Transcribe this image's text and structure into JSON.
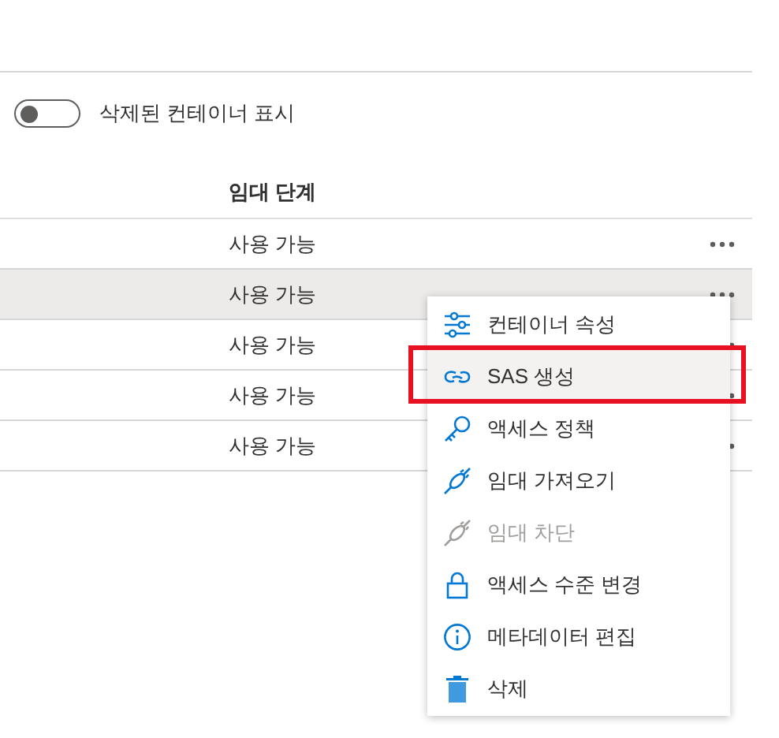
{
  "deleted_toggle": {
    "label": "삭제된 컨테이너 표시",
    "on": false
  },
  "table": {
    "columns": [
      {
        "label": "임대 단계"
      }
    ],
    "rows": [
      {
        "lease_state": "사용 가능",
        "hovered": false
      },
      {
        "lease_state": "사용 가능",
        "hovered": true
      },
      {
        "lease_state": "사용 가능",
        "hovered": false
      },
      {
        "lease_state": "사용 가능",
        "hovered": false
      },
      {
        "lease_state": "사용 가능",
        "hovered": false
      }
    ]
  },
  "context_menu": {
    "items": [
      {
        "kind": "properties",
        "label": "컨테이너 속성",
        "disabled": false,
        "hovered": false,
        "annotated": false
      },
      {
        "kind": "link",
        "label": "SAS 생성",
        "disabled": false,
        "hovered": true,
        "annotated": true
      },
      {
        "kind": "key",
        "label": "액세스 정책",
        "disabled": false,
        "hovered": false,
        "annotated": false
      },
      {
        "kind": "plug",
        "label": "임대 가져오기",
        "disabled": false,
        "hovered": false,
        "annotated": false
      },
      {
        "kind": "plug",
        "label": "임대 차단",
        "disabled": true,
        "hovered": false,
        "annotated": false
      },
      {
        "kind": "lock",
        "label": "액세스 수준 변경",
        "disabled": false,
        "hovered": false,
        "annotated": false
      },
      {
        "kind": "info",
        "label": "메타데이터 편집",
        "disabled": false,
        "hovered": false,
        "annotated": false
      },
      {
        "kind": "trash",
        "label": "삭제",
        "disabled": false,
        "hovered": false,
        "annotated": false
      }
    ]
  }
}
